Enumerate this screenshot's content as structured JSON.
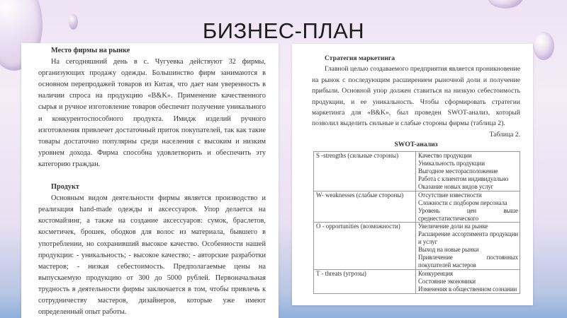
{
  "title": "БИЗНЕС-ПЛАН",
  "left_doc": {
    "heading1": "Место фирмы на рынке",
    "para1": "На сегодняшний день в с. Чугуевка действуют 32 фирмы, организующих продажу одежды. Большинство фирм занимаются в основном перепродажей товаров из Китая, что дает нам уверенность в наличии спроса на продукцию «B&K». Применение качественного сырья и ручное изготовление товаров обеспечит получение уникального и конкурентоспособного продукта. Имидж изделий ручного изготовления привлечет достаточный приток покупателей, так как такие товары достаточно популярны среди населения с высоким и низким уровнем дохода. Фирма способна удовлетворить и обеспечить эту категорию граждан.",
    "heading2": "Продукт",
    "para2": "Основным видом деятельности фирмы является производство и реализация hand-made одежды и аксессуаров. Упор делается на костомайзинг, а также на создание аксессуаров: сумок, браслетов, косметичек, брошек, ободков для волос из материала, бывшего в употреблении, но сохранивший высокое качество. Особенности нашей продукции: - уникальность; - высокое качество; - авторские разработки мастеров; - низкая себестоимость. Предполагаемые цены на выпускаемую продукцию от 300 до 5000 рублей. Первоначальная трудность в деятельности фирмы заключается в том, чтобы привлечь к сотрудничеству мастеров, дизайнеров, которые уже имеют определенный опыт работы."
  },
  "right_doc": {
    "heading": "Стратегия маркетинга",
    "para": "Главной целью создаваемого предприятия является проникновение на рынок с последующим расширением рыночной доли и получение прибыли. Основной упор должен ставиться на низкую себестоимость продукции, и ее уникальность. Чтобы сформировать стратегии маркетинга для «B&K», был проведен SWOT-анализ, который позволил выделить сильные и слабые стороны фирмы (таблица 2).",
    "caption": "Таблица 2.",
    "table_title": "SWOT-анализ",
    "rows": [
      {
        "label": "S -strengths (сильные стороны)",
        "items": [
          "Качество продукции",
          "Уникальность продукции",
          "Выгодное месторасположение",
          "Работа с клиентом индивидуально",
          "Оказание новых видов услуг"
        ]
      },
      {
        "label": "W- weaknesses (слабые стороны)",
        "items": [
          "Отсутствие известности",
          "Сложности с подбором персонала",
          "Уровень цен выше среднестатистического"
        ]
      },
      {
        "label": "O - opportunities (возможности)",
        "items": [
          "Увеличение доли на рынке",
          "Расширение ассортимента продукции и услуг",
          "Выход на новые рынки",
          "Привлечение постоянных покупателей мастеров"
        ]
      },
      {
        "label": "T - threats (угрозы)",
        "items": [
          "Конкуренция",
          "Состояние экономики",
          "Изменения в общественном сознании"
        ]
      }
    ]
  }
}
